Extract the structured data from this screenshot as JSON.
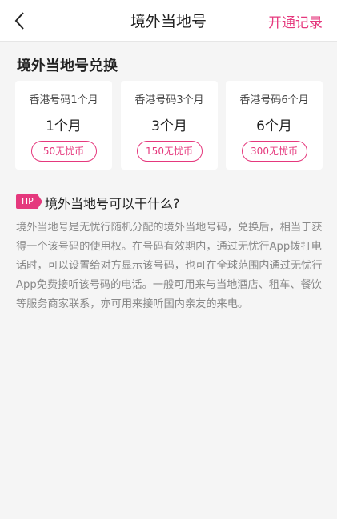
{
  "nav": {
    "title": "境外当地号",
    "action_label": "开通记录"
  },
  "section_title": "境外当地号兑换",
  "plans": [
    {
      "name": "香港号码1个月",
      "duration": "1个月",
      "price": "50无忧币"
    },
    {
      "name": "香港号码3个月",
      "duration": "3个月",
      "price": "150无忧币"
    },
    {
      "name": "香港号码6个月",
      "duration": "6个月",
      "price": "300无忧币"
    }
  ],
  "tip": {
    "badge": "TIP",
    "heading": "境外当地号可以干什么?",
    "body": "境外当地号是无忧行随机分配的境外当地号码，兑换后，相当于获得一个该号码的使用权。在号码有效期内，通过无忧行App拨打电话时，可以设置给对方显示该号码，也可在全球范围内通过无忧行App免费接听该号码的电话。一般可用来与当地酒店、租车、餐饮等服务商家联系，亦可用来接听国内亲友的来电。"
  },
  "colors": {
    "accent": "#e5387d",
    "background": "#f5f5f5",
    "card": "#ffffff"
  }
}
